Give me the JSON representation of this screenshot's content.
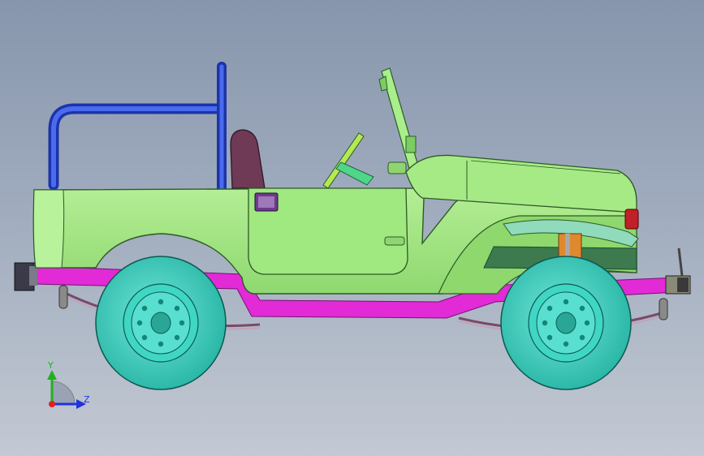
{
  "viewport": {
    "background_top": "#8796ad",
    "background_bottom": "#c3c9d3"
  },
  "model": {
    "body_color": "#9ee67e",
    "roll_bar_color": "#2b49c9",
    "frame_color": "#e22ad6",
    "wheel_color": "#3fd6c4",
    "seat_color": "#6e3a55",
    "stripe_color": "#3d7a4e"
  },
  "triad": {
    "y_label": "Y",
    "z_label": "Z",
    "y_color": "#22b022",
    "z_color": "#2233dd",
    "x_color": "#dd2222"
  }
}
